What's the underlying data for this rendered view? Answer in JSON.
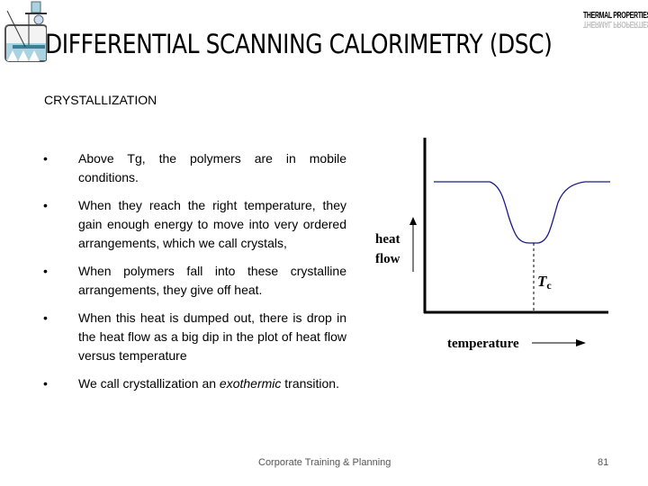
{
  "slide": {
    "title": "DIFFERENTIAL SCANNING CALORIMETRY (DSC)",
    "logo_text": "THERMAL PROPERTIES",
    "subtitle": "CRYSTALLIZATION",
    "bullets": [
      {
        "text": "Above Tg, the polymers are in mobile conditions."
      },
      {
        "text": "When they reach the right temperature, they gain enough energy to move into very ordered arrangements, which we call crystals,"
      },
      {
        "text": "When polymers fall into these crystalline arrangements, they give off heat."
      },
      {
        "text": "When this heat is dumped out, there is drop in the heat flow as a big dip in the plot of heat flow versus temperature"
      },
      {
        "text_prefix": "We call crystallization an ",
        "text_emphasis": "exothermic",
        "text_suffix": " transition."
      }
    ],
    "bullet_symbol": "•",
    "footer": "Corporate Training & Planning",
    "page_number": "81"
  },
  "diagram": {
    "y_label_line1": "heat",
    "y_label_line2": "flow",
    "x_label": "temperature",
    "marker_label": "T",
    "marker_subscript": "c",
    "curve_color": "#1a1a8c"
  }
}
